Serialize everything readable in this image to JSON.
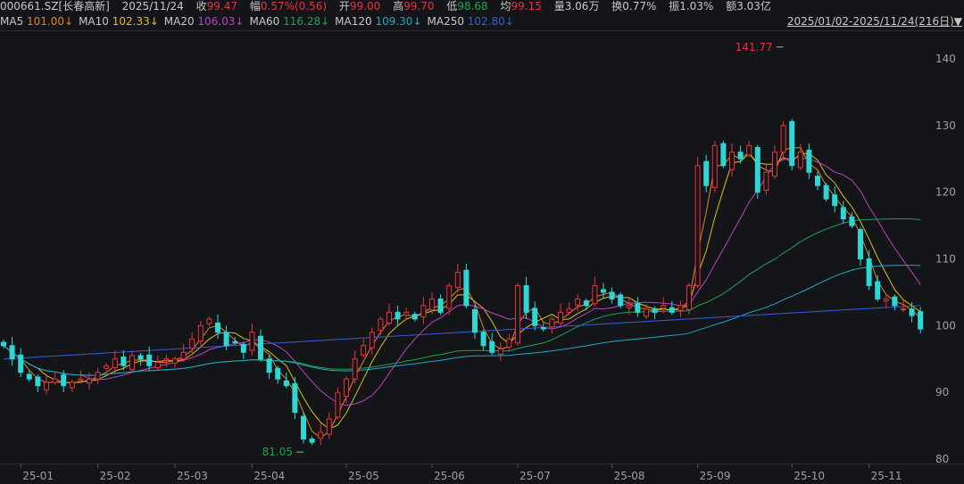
{
  "header": {
    "code": "000661.SZ[长春高新]",
    "date": "2025/11/24",
    "close_label": "收",
    "close": "99.47",
    "chg_label": "幅",
    "chg": "0.57%(0.56)",
    "open_label": "开",
    "open": "99.00",
    "high_label": "高",
    "high": "99.70",
    "low_label": "低",
    "low": "98.68",
    "avg_label": "均",
    "avg": "99.15",
    "vol": "量3.06万",
    "turnover": "换0.77%",
    "amp": "振1.03%",
    "amount": "额3.03亿"
  },
  "ma": [
    {
      "name": "MA5",
      "value": "101.00↓",
      "color": "#e8801a"
    },
    {
      "name": "MA10",
      "value": "102.33↓",
      "color": "#d8c020"
    },
    {
      "name": "MA20",
      "value": "106.03↓",
      "color": "#c040c0"
    },
    {
      "name": "MA60",
      "value": "116.28↓",
      "color": "#20a050"
    },
    {
      "name": "MA120",
      "value": "109.30↓",
      "color": "#20a8c0"
    },
    {
      "name": "MA250",
      "value": "102.80↓",
      "color": "#3a5ad8"
    }
  ],
  "range_label": "2025/01/02-2025/11/24(216日)▼",
  "colors": {
    "up": "#e8333a",
    "down": "#2fd6d6"
  },
  "chart_data": {
    "type": "candlestick",
    "ylim": [
      78,
      143
    ],
    "yticks": [
      "80",
      "90",
      "100",
      "110",
      "120",
      "130",
      "140"
    ],
    "xticks": [
      "25-01",
      "25-02",
      "25-03",
      "25-04",
      "25-05",
      "25-06",
      "25-07",
      "25-08",
      "25-09",
      "25-10",
      "25-11"
    ],
    "xtick_index": [
      2,
      11,
      20,
      29,
      40,
      50,
      60,
      71,
      81,
      92,
      101
    ],
    "close": [
      97,
      95,
      93,
      92,
      91,
      91.5,
      92,
      91,
      91.5,
      92,
      92,
      93,
      94,
      95,
      94,
      95.5,
      95,
      94,
      94.5,
      95,
      95,
      96,
      98,
      100,
      101,
      99,
      97,
      97.5,
      96,
      99,
      95,
      93,
      92,
      91,
      87,
      83,
      82.5,
      84,
      86,
      90,
      92,
      95,
      97,
      99,
      101,
      102,
      101,
      102,
      101,
      103,
      104,
      102,
      106,
      108,
      103,
      99,
      97,
      96,
      96.5,
      98,
      106,
      102,
      100,
      99.5,
      101,
      102,
      102.5,
      104,
      103,
      106,
      105,
      104,
      103,
      103,
      102,
      102.5,
      102,
      103,
      102,
      103,
      106,
      124,
      121,
      127,
      124,
      126,
      125,
      127,
      120,
      123,
      126,
      130,
      124,
      126,
      123,
      121,
      119,
      118,
      116,
      115,
      110,
      106,
      104,
      104,
      103,
      102.5,
      101.5,
      99.5
    ],
    "annotations": [
      {
        "label": "141.77",
        "value": 141.77,
        "index": 91
      },
      {
        "label": "81.05",
        "value": 81.05,
        "index": 35
      }
    ]
  }
}
